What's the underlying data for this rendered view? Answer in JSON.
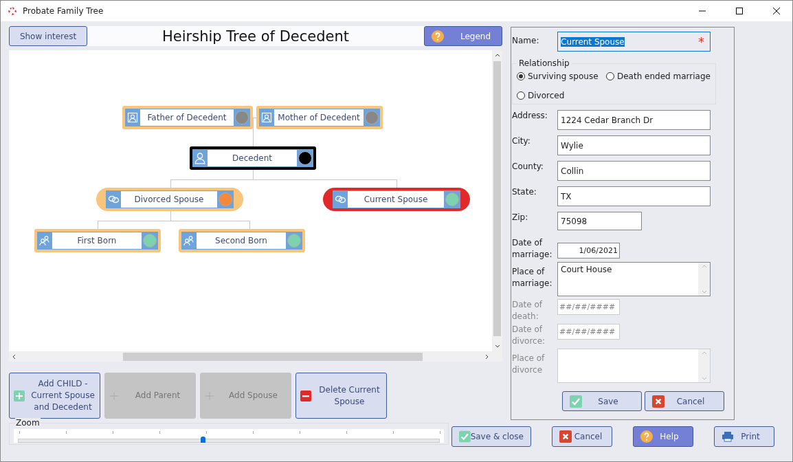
{
  "window": {
    "title": "Probate Family Tree"
  },
  "header": {
    "show_interest": "Show interest",
    "title": "Heirship Tree of Decedent",
    "legend": "Legend"
  },
  "tree": {
    "parents": [
      {
        "label": "Father of Decedent",
        "color": "#888888",
        "selected": false
      },
      {
        "label": "Mother of Decedent",
        "color": "#888888",
        "selected": false
      }
    ],
    "decedent": {
      "label": "Decedent",
      "color": "#000000",
      "selected": false
    },
    "spouses": [
      {
        "label": "Divorced Spouse",
        "color": "#f5883a",
        "selected": false,
        "children": [
          {
            "label": "First Born",
            "color": "#7dd3b0",
            "selected": false
          },
          {
            "label": "Second Born",
            "color": "#7dd3b0",
            "selected": false
          }
        ]
      },
      {
        "label": "Current Spouse",
        "color": "#7dd3b0",
        "selected": true
      }
    ]
  },
  "actions": [
    {
      "label": "Add CHILD - Current Spouse and Decedent",
      "kind": "add",
      "disabled": false
    },
    {
      "label": "Add Parent",
      "kind": "add",
      "disabled": true
    },
    {
      "label": "Add Spouse",
      "kind": "add",
      "disabled": true
    },
    {
      "label": "Delete Current Spouse",
      "kind": "delete",
      "disabled": false
    }
  ],
  "zoom": {
    "label": "Zoom",
    "level": 0.44
  },
  "form": {
    "name": {
      "label": "Name:",
      "value": "Current Spouse",
      "required_mark": "*"
    },
    "relationship": {
      "legend": "Relationship",
      "options": [
        {
          "label": "Surviving spouse",
          "selected": true
        },
        {
          "label": "Death ended marriage",
          "selected": false
        },
        {
          "label": "Divorced",
          "selected": false
        }
      ]
    },
    "fields": [
      {
        "label": "Address:",
        "value": "1224 Cedar Branch Dr",
        "kind": "text",
        "disabled": false
      },
      {
        "label": "City:",
        "value": "Wylie",
        "kind": "text",
        "disabled": false
      },
      {
        "label": "County:",
        "value": "Collin",
        "kind": "text",
        "disabled": false
      },
      {
        "label": "State:",
        "value": "TX",
        "kind": "text",
        "disabled": false
      },
      {
        "label": "Zip:",
        "value": "75098",
        "kind": "short",
        "disabled": false
      },
      {
        "label": "Date of marriage:",
        "value": "1/06/2021",
        "kind": "date",
        "disabled": false
      },
      {
        "label": "Place of marriage:",
        "value": "Court House",
        "kind": "memo",
        "disabled": false
      },
      {
        "label": "Date of death:",
        "placeholder": "##/##/####",
        "kind": "date",
        "disabled": true
      },
      {
        "label": "Date of divorce:",
        "placeholder": "##/##/####",
        "kind": "date",
        "disabled": true
      },
      {
        "label": "Place of divorce",
        "kind": "memo",
        "disabled": true
      }
    ],
    "buttons": [
      {
        "label": "Save",
        "kind": "ok"
      },
      {
        "label": "Cancel",
        "kind": "cancel"
      }
    ]
  },
  "footer": [
    {
      "label": "Save & close",
      "kind": "ok"
    },
    {
      "label": "Cancel",
      "kind": "cancel"
    },
    {
      "label": "Help",
      "kind": "help"
    },
    {
      "label": "Print",
      "kind": "print"
    }
  ]
}
